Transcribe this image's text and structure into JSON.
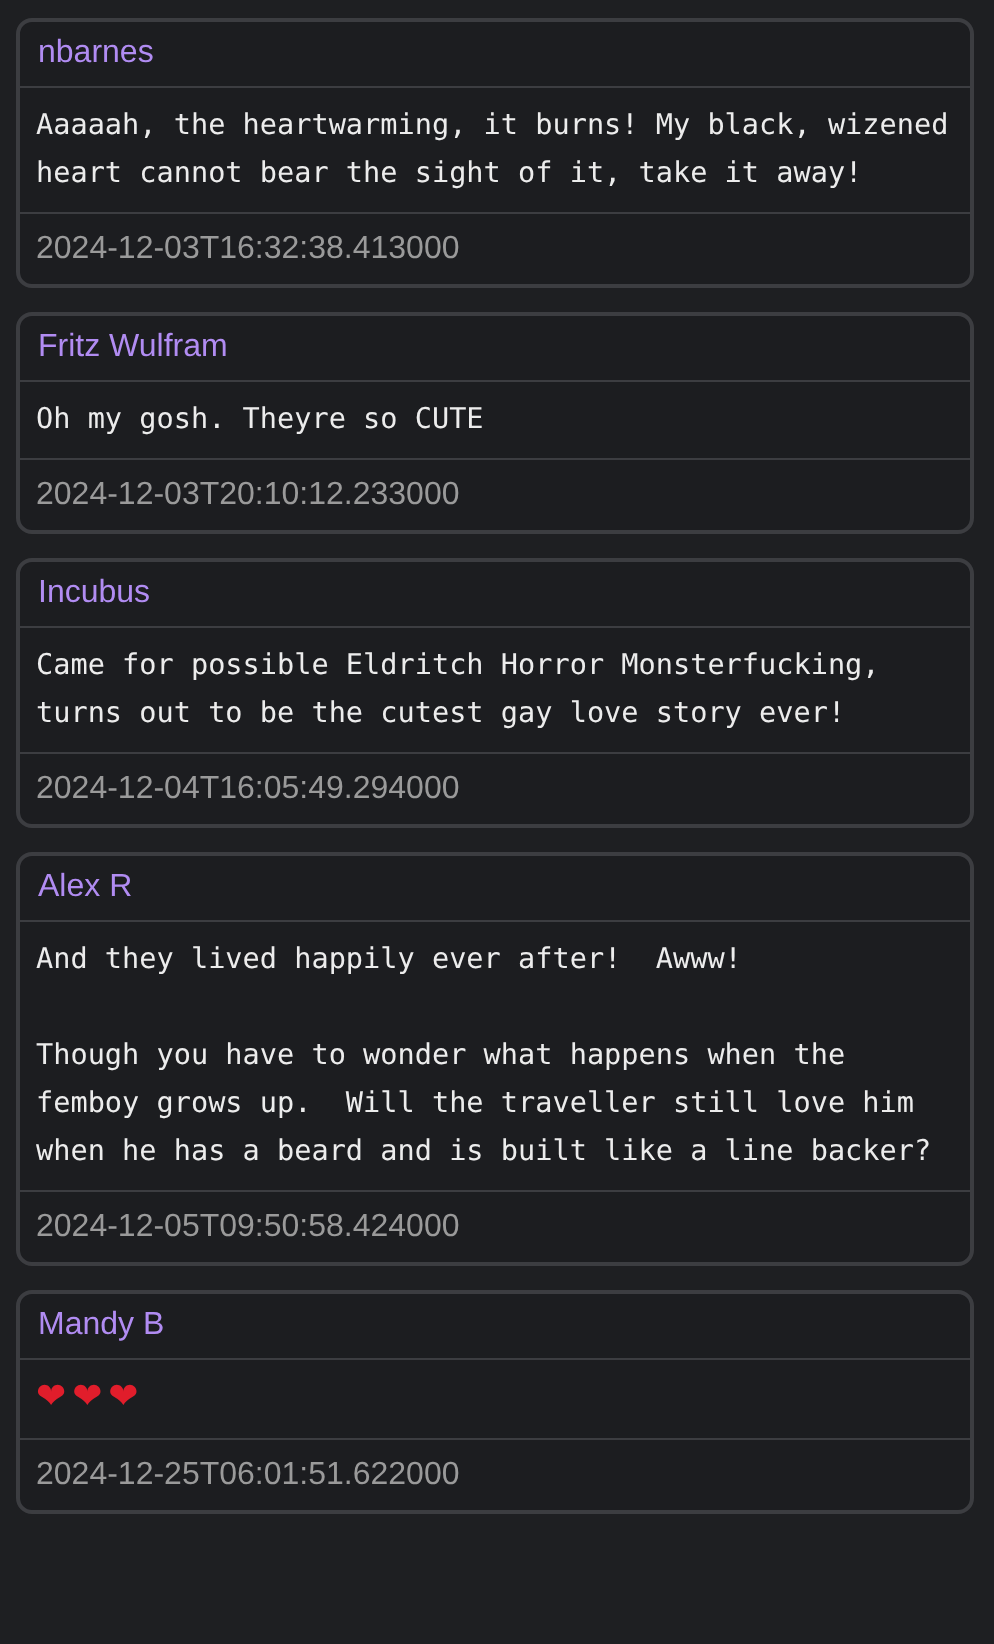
{
  "comments": [
    {
      "author": "nbarnes",
      "body": "Aaaaah, the heartwarming, it burns! My black, wizened heart cannot bear the sight of it, take it away!",
      "timestamp": "2024-12-03T16:32:38.413000"
    },
    {
      "author": "Fritz Wulfram",
      "body": "Oh my gosh. Theyre so CUTE",
      "timestamp": "2024-12-03T20:10:12.233000"
    },
    {
      "author": "Incubus",
      "body": "Came for possible Eldritch Horror Monsterfucking, turns out to be the cutest gay love story ever!",
      "timestamp": "2024-12-04T16:05:49.294000"
    },
    {
      "author": "Alex R",
      "body": "And they lived happily ever after!  Awww!\n\nThough you have to wonder what happens when the femboy grows up.  Will the traveller still love him when he has a beard and is built like a line backer?",
      "timestamp": "2024-12-05T09:50:58.424000"
    },
    {
      "author": "Mandy B",
      "body": "❤❤❤",
      "timestamp": "2024-12-25T06:01:51.622000"
    }
  ]
}
